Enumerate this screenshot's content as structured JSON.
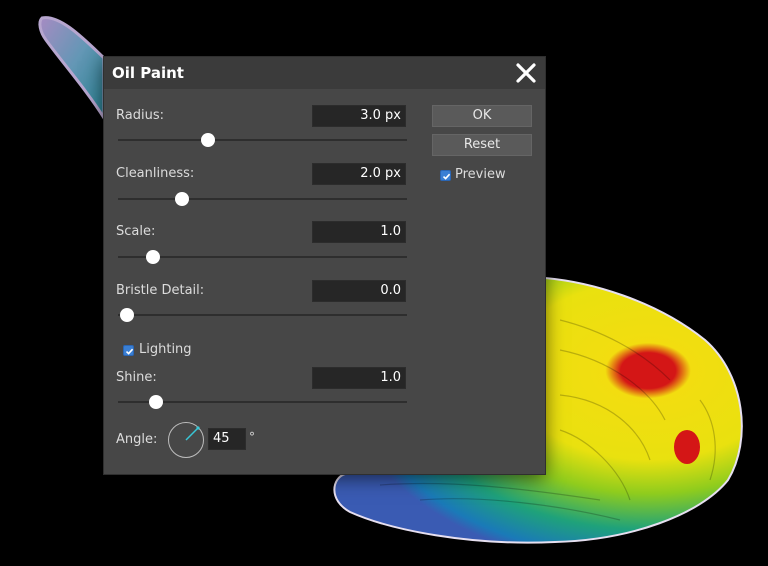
{
  "dialog": {
    "title": "Oil Paint",
    "ok_label": "OK",
    "reset_label": "Reset",
    "preview_label": "Preview",
    "preview_checked": true
  },
  "params": {
    "radius": {
      "label": "Radius:",
      "value": "3.0 px",
      "fraction": 0.31
    },
    "cleanliness": {
      "label": "Cleanliness:",
      "value": "2.0 px",
      "fraction": 0.22
    },
    "scale": {
      "label": "Scale:",
      "value": "1.0",
      "fraction": 0.12
    },
    "bristle": {
      "label": "Bristle Detail:",
      "value": "0.0",
      "fraction": 0.03
    },
    "lighting_label": "Lighting",
    "lighting_checked": true,
    "shine": {
      "label": "Shine:",
      "value": "1.0",
      "fraction": 0.13
    },
    "angle": {
      "label": "Angle:",
      "value": "45",
      "unit": "°"
    }
  },
  "colors": {
    "accent": "#3a7fd4",
    "dialog_bg": "#474747",
    "titlebar_bg": "#3b3b3b",
    "dial_indicator": "#38c7d6"
  }
}
